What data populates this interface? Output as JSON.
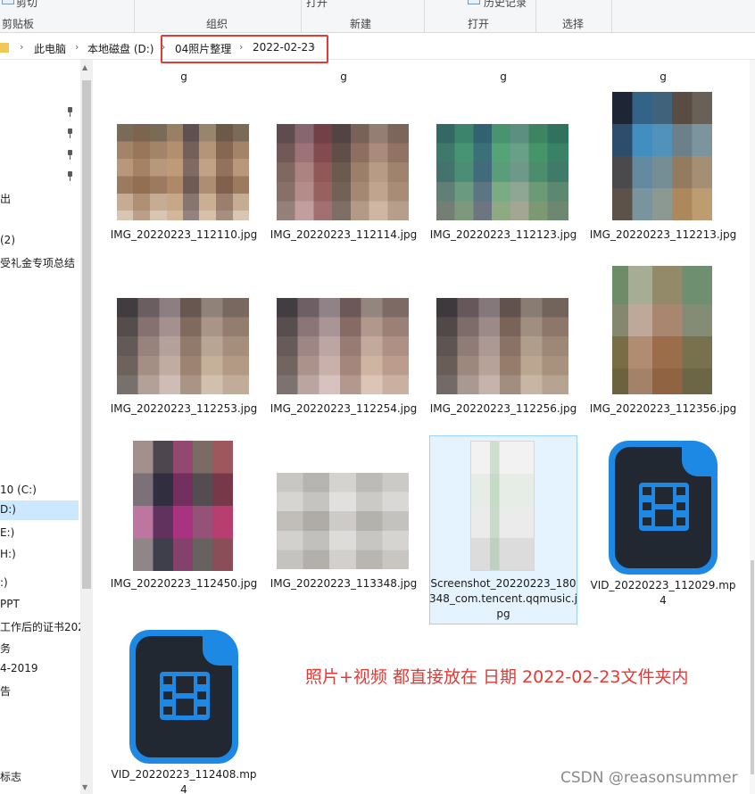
{
  "ribbon": {
    "top_labels": [
      "剪切",
      "打开",
      "历史记录"
    ],
    "groups": [
      "剪贴板",
      "组织",
      "新建",
      "打开",
      "选择"
    ]
  },
  "address": {
    "crumbs": [
      "此电脑",
      "本地磁盘 (D:)",
      "04照片整理",
      "2022-02-23"
    ]
  },
  "nav": {
    "items": [
      "出",
      "(2)",
      "受礼金专项总结",
      "10 (C:)",
      "D:)",
      "E:)",
      "H:)",
      ":)",
      "PPT",
      "工作后的证书202",
      "务",
      "4-2019",
      "告",
      "标志"
    ]
  },
  "files": {
    "top_partial": [
      "g",
      "g",
      "g",
      "g"
    ],
    "row1": [
      "IMG_20220223_112110.jpg",
      "IMG_20220223_112114.jpg",
      "IMG_20220223_112123.jpg",
      "IMG_20220223_112213.jpg"
    ],
    "row2": [
      "IMG_20220223_112253.jpg",
      "IMG_20220223_112254.jpg",
      "IMG_20220223_112256.jpg",
      "IMG_20220223_112356.jpg"
    ],
    "row3": [
      "IMG_20220223_112450.jpg",
      "IMG_20220223_113348.jpg",
      "Screenshot_20220223_180348_com.tencent.qqmusic.jpg",
      "VID_20220223_112029.mp4"
    ],
    "row4": [
      "VID_20220223_112408.mp4"
    ]
  },
  "annotation": "照片+视频 都直接放在 日期 2022-02-23文件夹内",
  "watermark": "CSDN @reasonsummer"
}
